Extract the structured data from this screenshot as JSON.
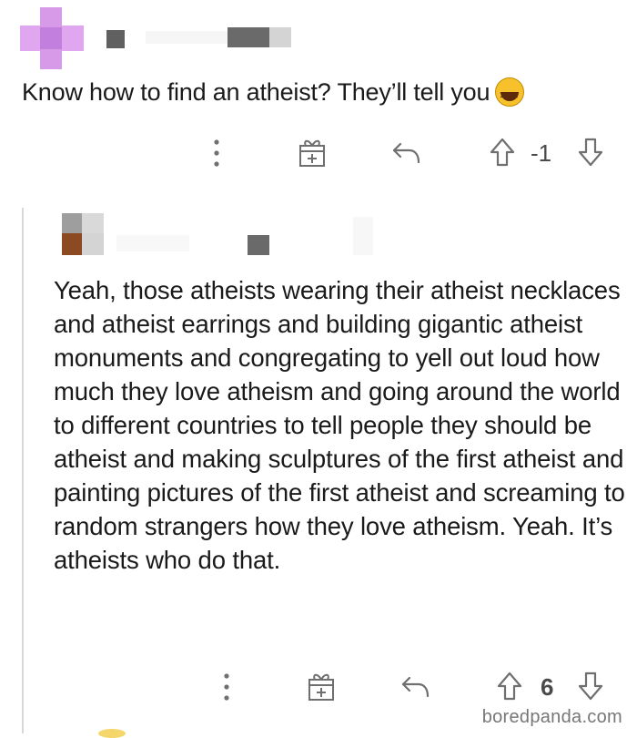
{
  "top_comment": {
    "text": "Know how to find an atheist? They’ll tell you",
    "emoji": "laughing-face-emoji",
    "score": "-1"
  },
  "reply": {
    "text": "Yeah, those atheists wearing their atheist necklaces and atheist earrings and building gigantic atheist monuments and congregating to yell out loud how much they love atheism and going around the world to different countries to tell people they should be atheist and making sculptures of the first atheist and painting pictures of the first atheist and screaming to random strangers how they love atheism. Yeah. It’s atheists who do that.",
    "score": "6"
  },
  "actions": {
    "icons": [
      "more-options-icon",
      "award-gift-icon",
      "reply-arrow-icon",
      "upvote-arrow-icon",
      "downvote-arrow-icon"
    ]
  },
  "watermark": "boredpanda.com",
  "colors": {
    "avatar_purple": "#d79ae9",
    "icon_gray": "#6f6f6f",
    "text": "#1a1a1b"
  }
}
